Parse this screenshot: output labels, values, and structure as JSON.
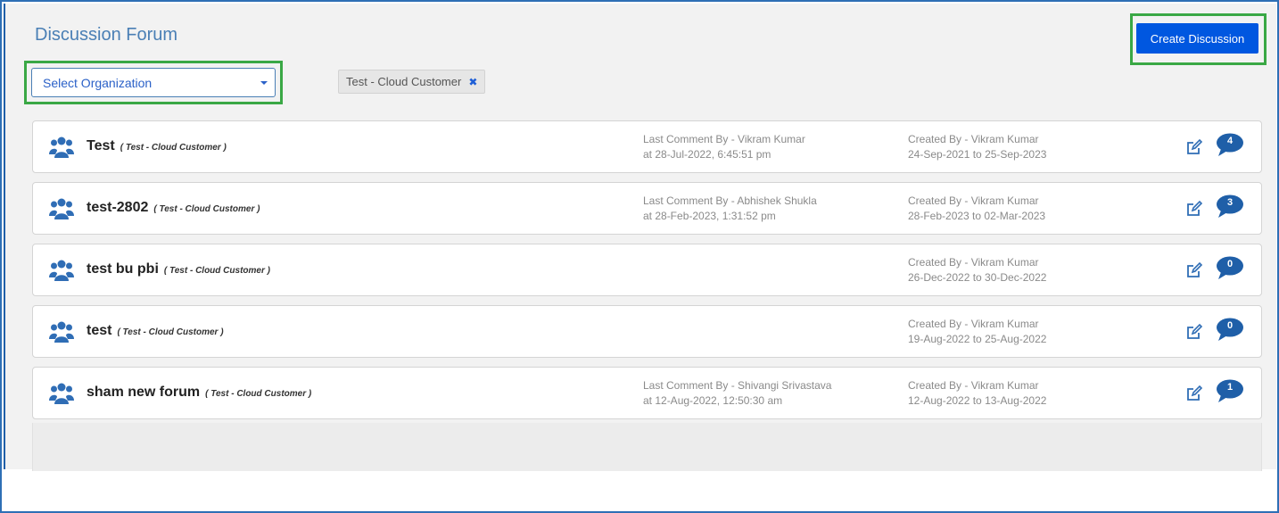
{
  "header": {
    "title": "Discussion Forum",
    "create_button_label": "Create Discussion"
  },
  "filters": {
    "organization_select": "Select Organization",
    "active_chip": "Test - Cloud Customer"
  },
  "icons": {
    "row_icon": "users-group-icon",
    "edit": "edit-icon",
    "comments": "comment-bubble-icon",
    "chip_remove": "close-icon",
    "dropdown": "caret-down-icon"
  },
  "colors": {
    "accent": "#0057e0",
    "title_blue": "#4a7fb5",
    "icon_blue": "#2f6db5",
    "highlight_green": "#3aa845"
  },
  "discussions": [
    {
      "title": "Test",
      "org": "( Test - Cloud Customer )",
      "last_comment_by": "Last Comment By - Vikram Kumar",
      "last_comment_at": "at 28-Jul-2022, 6:45:51 pm",
      "created_by": "Created By - Vikram Kumar",
      "date_range": "24-Sep-2021 to 25-Sep-2023",
      "comment_count": "4"
    },
    {
      "title": "test-2802",
      "org": "( Test - Cloud Customer )",
      "last_comment_by": "Last Comment By - Abhishek Shukla",
      "last_comment_at": "at 28-Feb-2023, 1:31:52 pm",
      "created_by": "Created By - Vikram Kumar",
      "date_range": "28-Feb-2023 to 02-Mar-2023",
      "comment_count": "3"
    },
    {
      "title": "test bu pbi",
      "org": "( Test - Cloud Customer )",
      "last_comment_by": "",
      "last_comment_at": "",
      "created_by": "Created By - Vikram Kumar",
      "date_range": "26-Dec-2022 to 30-Dec-2022",
      "comment_count": "0"
    },
    {
      "title": "test",
      "org": "( Test - Cloud Customer )",
      "last_comment_by": "",
      "last_comment_at": "",
      "created_by": "Created By - Vikram Kumar",
      "date_range": "19-Aug-2022 to 25-Aug-2022",
      "comment_count": "0"
    },
    {
      "title": "sham new forum",
      "org": "( Test - Cloud Customer )",
      "last_comment_by": "Last Comment By - Shivangi Srivastava",
      "last_comment_at": "at 12-Aug-2022, 12:50:30 am",
      "created_by": "Created By - Vikram Kumar",
      "date_range": "12-Aug-2022 to 13-Aug-2022",
      "comment_count": "1"
    }
  ]
}
